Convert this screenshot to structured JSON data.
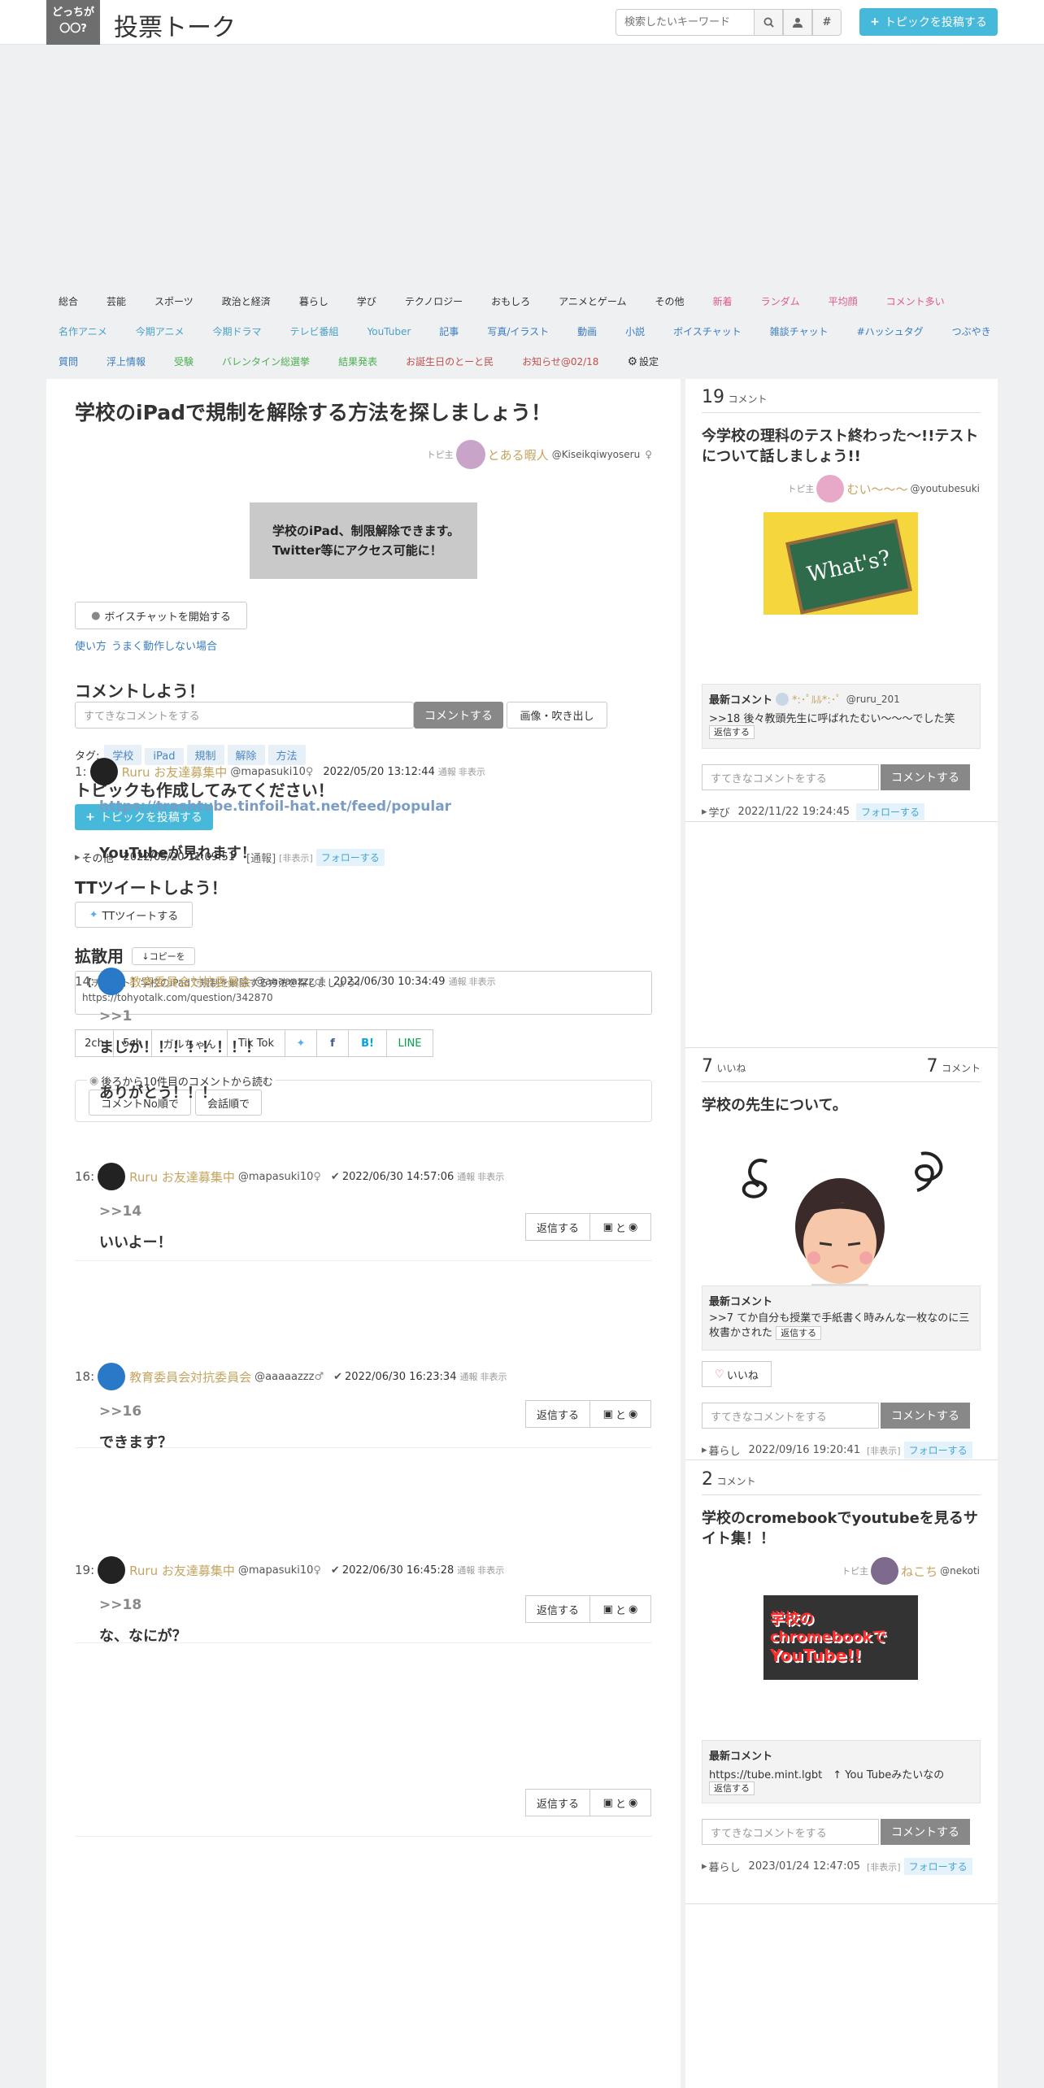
{
  "header": {
    "logo_line1": "どっちが",
    "logo_line2": "〇〇?",
    "site_title": "投票トーク",
    "search_placeholder": "検索したいキーワード",
    "search_icon": "search-icon",
    "user_icon": "user-icon",
    "hash_icon": "hashtag-icon",
    "post_button": "トピックを投稿する"
  },
  "nav": {
    "row1": [
      {
        "label": "総合",
        "color": "#333333"
      },
      {
        "label": "芸能",
        "color": "#333333"
      },
      {
        "label": "スポーツ",
        "color": "#333333"
      },
      {
        "label": "政治と経済",
        "color": "#333333"
      },
      {
        "label": "暮らし",
        "color": "#333333"
      },
      {
        "label": "学び",
        "color": "#333333"
      },
      {
        "label": "テクノロジー",
        "color": "#333333"
      },
      {
        "label": "おもしろ",
        "color": "#333333"
      },
      {
        "label": "アニメとゲーム",
        "color": "#333333"
      },
      {
        "label": "その他",
        "color": "#333333"
      },
      {
        "label": "新着",
        "color": "#e05a8c"
      },
      {
        "label": "ランダム",
        "color": "#e05a8c"
      },
      {
        "label": "平均顔",
        "color": "#e05a8c"
      },
      {
        "label": "コメント多い",
        "color": "#e05a8c"
      }
    ],
    "row2": [
      {
        "label": "名作アニメ",
        "color": "#4aa0c8"
      },
      {
        "label": "今期アニメ",
        "color": "#4aa0c8"
      },
      {
        "label": "今期ドラマ",
        "color": "#4aa0c8"
      },
      {
        "label": "テレビ番組",
        "color": "#4aa0c8"
      },
      {
        "label": "YouTuber",
        "color": "#4aa0c8"
      },
      {
        "label": "記事",
        "color": "#3a7cc0"
      },
      {
        "label": "写真/イラスト",
        "color": "#3a7cc0"
      },
      {
        "label": "動画",
        "color": "#3a7cc0"
      },
      {
        "label": "小説",
        "color": "#3a7cc0"
      },
      {
        "label": "ボイスチャット",
        "color": "#3a7cc0"
      },
      {
        "label": "雑談チャット",
        "color": "#3a7cc0"
      },
      {
        "label": "#ハッシュタグ",
        "color": "#3a7cc0"
      },
      {
        "label": "つぶやき",
        "color": "#3a7cc0"
      }
    ],
    "row3": [
      {
        "label": "質問",
        "color": "#3a7cc0"
      },
      {
        "label": "浮上情報",
        "color": "#3a7cc0"
      },
      {
        "label": "受験",
        "color": "#4caf50"
      },
      {
        "label": "バレンタイン総選挙",
        "color": "#4caf50"
      },
      {
        "label": "結果発表",
        "color": "#4caf50"
      },
      {
        "label": "お誕生日のとーと民",
        "color": "#c0504d"
      },
      {
        "label": "お知らせ@02/18",
        "color": "#c0504d"
      },
      {
        "label": "設定",
        "color": "#333333"
      }
    ]
  },
  "topic": {
    "title": "学校のiPadで規制を解除する方法を探しましょう！",
    "owner_prefix": "トピ主",
    "owner_name": "とある暇人",
    "owner_id": "@Kiseikqiwyoseru",
    "owner_gender": "♀",
    "image_line1": "学校のiPad、制限解除できます。",
    "image_line2": "Twitter等にアクセス可能に！",
    "voice_button": "ボイスチャットを開始する",
    "help_link1": "使い方",
    "help_link2": "うまく動作しない場合",
    "comment_heading": "コメントしよう！",
    "comment_placeholder": "すてきなコメントをする",
    "comment_button": "コメントする",
    "image_button": "画像・吹き出し",
    "tags_label": "タグ:",
    "tags": [
      "学校",
      "iPad",
      "規制",
      "解除",
      "方法"
    ],
    "create_heading": "トピックも作成してみてください！",
    "create_button": "トピックを投稿する",
    "category": "その他",
    "date": "2022/05/20 11:09:51",
    "report": "[通報]",
    "hide": "[非表示]",
    "follow": "フォローする",
    "tt_heading": "TTツイートしよう！",
    "tt_button": "TTツイートする",
    "spread_heading": "拡散用",
    "copy_button": "↓コピーを",
    "spread_text1": "【チャット】学校のiPadで規制を解除する方法を探しましょう！",
    "spread_text2": "https://tohyotalk.com/question/342870",
    "share": [
      "2ch",
      "5ch",
      "ガルちゃん",
      "Tik Tok",
      "",
      "",
      "B!",
      "LINE"
    ],
    "read_text": "後ろから10件目のコメントから読む",
    "order1": "コメントNo順で",
    "order2": "会話順で",
    "reply": "返信する",
    "img_btn": "と"
  },
  "comments": [
    {
      "no": "1:",
      "name": "Ruru お友達募集中",
      "id": "@mapasuki10",
      "gender": "♀",
      "date": "2022/05/20 13:12:44",
      "report": "通報",
      "hide": "非表示",
      "lines": [
        "https://trashtube.tinfoil-hat.net/feed/popular",
        "YouTubeが見れます！"
      ]
    },
    {
      "no": "14:",
      "name": "教育委員会対抗委員会",
      "id": "@aaaaazzz",
      "gender": "♂",
      "date": "2022/06/30 10:34:49",
      "report": "通報",
      "hide": "非表示",
      "lines": [
        ">>1",
        "まじか！！！！！！！！",
        "ありがとう！！！"
      ]
    },
    {
      "no": "16:",
      "name": "Ruru お友達募集中",
      "id": "@mapasuki10",
      "gender": "♀",
      "date": "2022/06/30 14:57:06",
      "report": "通報",
      "hide": "非表示",
      "lines": [
        ">>14",
        "いいよー！"
      ]
    },
    {
      "no": "18:",
      "name": "教育委員会対抗委員会",
      "id": "@aaaaazzz",
      "gender": "♂",
      "date": "2022/06/30 16:23:34",
      "report": "通報",
      "hide": "非表示",
      "lines": [
        ">>16",
        "できます？"
      ]
    },
    {
      "no": "19:",
      "name": "Ruru お友達募集中",
      "id": "@mapasuki10",
      "gender": "♀",
      "date": "2022/06/30 16:45:28",
      "report": "通報",
      "hide": "非表示",
      "lines": [
        ">>18",
        "な、なにが？"
      ]
    }
  ],
  "side": [
    {
      "count": "19",
      "count_label": "コメント",
      "title": "今学校の理科のテスト終わった〜!!テストについて話しましょう!!",
      "owner_prefix": "トピ主",
      "owner": "むい〜〜〜",
      "owner_id": "@youtubesuki",
      "img_text": "What's?",
      "latest_label": "最新コメント",
      "latest_user": "*:･ﾟﾙﾙ*:･ﾟ",
      "latest_id": "@ruru_201",
      "latest_text": ">>18 後々教頭先生に呼ばれたむい～～～でした笑",
      "reply": "返信する",
      "placeholder": "すてきなコメントをする",
      "button": "コメントする",
      "cat": "学び",
      "date": "2022/11/22 19:24:45",
      "follow": "フォローする"
    },
    {
      "likes": "7",
      "likes_label": "いいね",
      "count": "7",
      "count_label": "コメント",
      "title": "学校の先生について。",
      "latest_label": "最新コメント",
      "latest_text": ">>7 てか自分も授業で手紙書く時みんな一枚なのに三枚書かされた",
      "reply": "返信する",
      "like_button": "いいね",
      "placeholder": "すてきなコメントをする",
      "button": "コメントする",
      "cat": "暮らし",
      "date": "2022/09/16 19:20:41",
      "hide": "[非表示]",
      "follow": "フォローする"
    },
    {
      "count": "2",
      "count_label": "コメント",
      "title": "学校のcromebookでyoutubeを見るサイト集！！",
      "owner_prefix": "トピ主",
      "owner": "ねこち",
      "owner_id": "@nekoti",
      "img_line1": "学校の",
      "img_line2": "chromebookで",
      "img_line3": "YouTube!!",
      "latest_label": "最新コメント",
      "latest_text": "https://tube.mint.lgbt　↑ You Tubeみたいなの",
      "reply": "返信する",
      "placeholder": "すてきなコメントをする",
      "button": "コメントする",
      "cat": "暮らし",
      "date": "2023/01/24 12:47:05",
      "hide": "[非表示]",
      "follow": "フォローする"
    }
  ]
}
